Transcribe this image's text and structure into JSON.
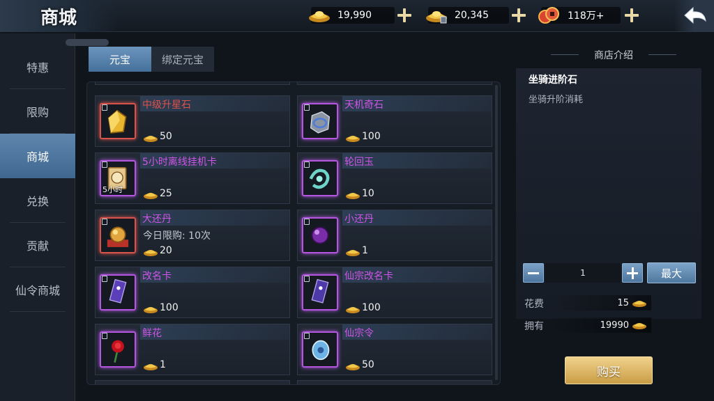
{
  "header": {
    "title": "商城",
    "currencies": [
      {
        "name": "gold-ingot",
        "value": "19,990"
      },
      {
        "name": "bound-gold-ingot",
        "value": "20,345"
      },
      {
        "name": "copper-coins",
        "value": "118万+"
      }
    ]
  },
  "nav": {
    "items": [
      {
        "label": "特惠"
      },
      {
        "label": "限购"
      },
      {
        "label": "商城",
        "active": true
      },
      {
        "label": "兑换"
      },
      {
        "label": "贡献"
      },
      {
        "label": "仙令商城"
      }
    ]
  },
  "tabs": [
    {
      "label": "元宝",
      "active": true
    },
    {
      "label": "绑定元宝",
      "active": false
    }
  ],
  "items": [
    {
      "name": "中级升星石",
      "name_color": "#e0524a",
      "price": "50",
      "icon": "yellow-gem-icon",
      "frame": "red"
    },
    {
      "name": "天机奇石",
      "name_color": "#cf55e6",
      "price": "100",
      "icon": "cube-stone-icon",
      "frame": "purple"
    },
    {
      "name": "5小时离线挂机卡",
      "name_color": "#cf55e6",
      "price": "25",
      "icon": "hourglass-card-icon",
      "frame": "purple",
      "badge": "5小时"
    },
    {
      "name": "轮回玉",
      "name_color": "#cf55e6",
      "price": "10",
      "icon": "jade-dragon-icon",
      "frame": "purple"
    },
    {
      "name": "大还丹",
      "name_color": "#cf55e6",
      "price": "20",
      "icon": "golden-pill-icon",
      "frame": "red",
      "limit": "今日限购: 10次"
    },
    {
      "name": "小还丹",
      "name_color": "#cf55e6",
      "price": "1",
      "icon": "purple-pill-icon",
      "frame": "purple"
    },
    {
      "name": "改名卡",
      "name_color": "#cf55e6",
      "price": "100",
      "icon": "rename-card-icon",
      "frame": "purple"
    },
    {
      "name": "仙宗改名卡",
      "name_color": "#cf55e6",
      "price": "100",
      "icon": "sect-rename-card-icon",
      "frame": "purple"
    },
    {
      "name": "鲜花",
      "name_color": "#cf55e6",
      "price": "1",
      "icon": "rose-icon",
      "frame": "purple"
    },
    {
      "name": "仙宗令",
      "name_color": "#cf55e6",
      "price": "50",
      "icon": "sect-token-icon",
      "frame": "purple"
    }
  ],
  "info": {
    "header": "商店介绍",
    "title": "坐骑进阶石",
    "desc": "坐骑升阶消耗"
  },
  "purchase": {
    "quantity": "1",
    "max_label": "最大",
    "cost_label": "花费",
    "cost_value": "15",
    "own_label": "拥有",
    "own_value": "19990",
    "buy_label": "购买"
  }
}
